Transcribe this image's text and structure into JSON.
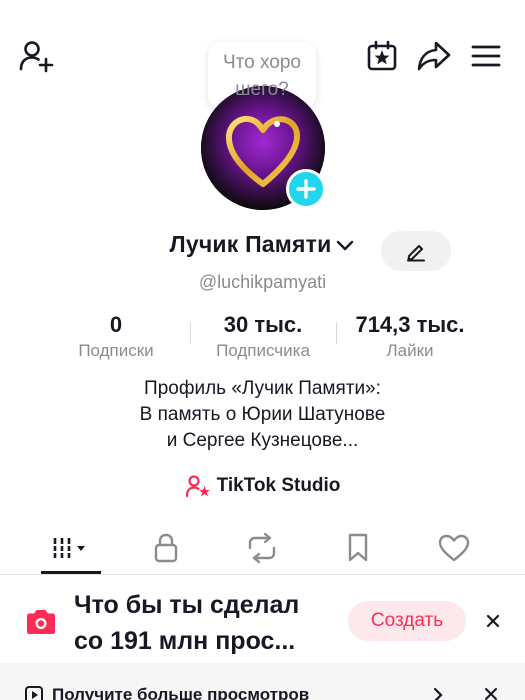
{
  "header": {
    "icons": [
      "add-friend-icon",
      "calendar-star-icon",
      "share-icon",
      "menu-icon"
    ]
  },
  "tooltip": {
    "line1": "Что хоро",
    "line2": "шего?"
  },
  "profile": {
    "display_name": "Лучик Памяти",
    "username": "@luchikpamyati",
    "avatar": "golden-heart-on-purple"
  },
  "stats": {
    "following_value": "0",
    "following_label": "Подписки",
    "followers_value": "30 тыс.",
    "followers_label": "Подписчика",
    "likes_value": "714,3 тыс.",
    "likes_label": "Лайки"
  },
  "bio": {
    "line1": "Профиль «Лучик Памяти»:",
    "line2": "В память о Юрии Шатунове",
    "line3": "и Сергее Кузнецове..."
  },
  "studio": {
    "label": "TikTok Studio"
  },
  "tabs": [
    "videos-grid-icon",
    "lock-icon",
    "repost-icon",
    "bookmark-icon",
    "heart-icon"
  ],
  "promo": {
    "line1": "Что бы ты сделал",
    "line2": "со 191 млн прос...",
    "create_label": "Создать"
  },
  "bottom_banner": {
    "text": "Получите больше просмотров"
  },
  "colors": {
    "accent": "#fe2c55",
    "accent_bg": "#fde8ec",
    "avatar_plus": "#20d5ec",
    "text": "#161823",
    "muted": "#8a8b91"
  }
}
